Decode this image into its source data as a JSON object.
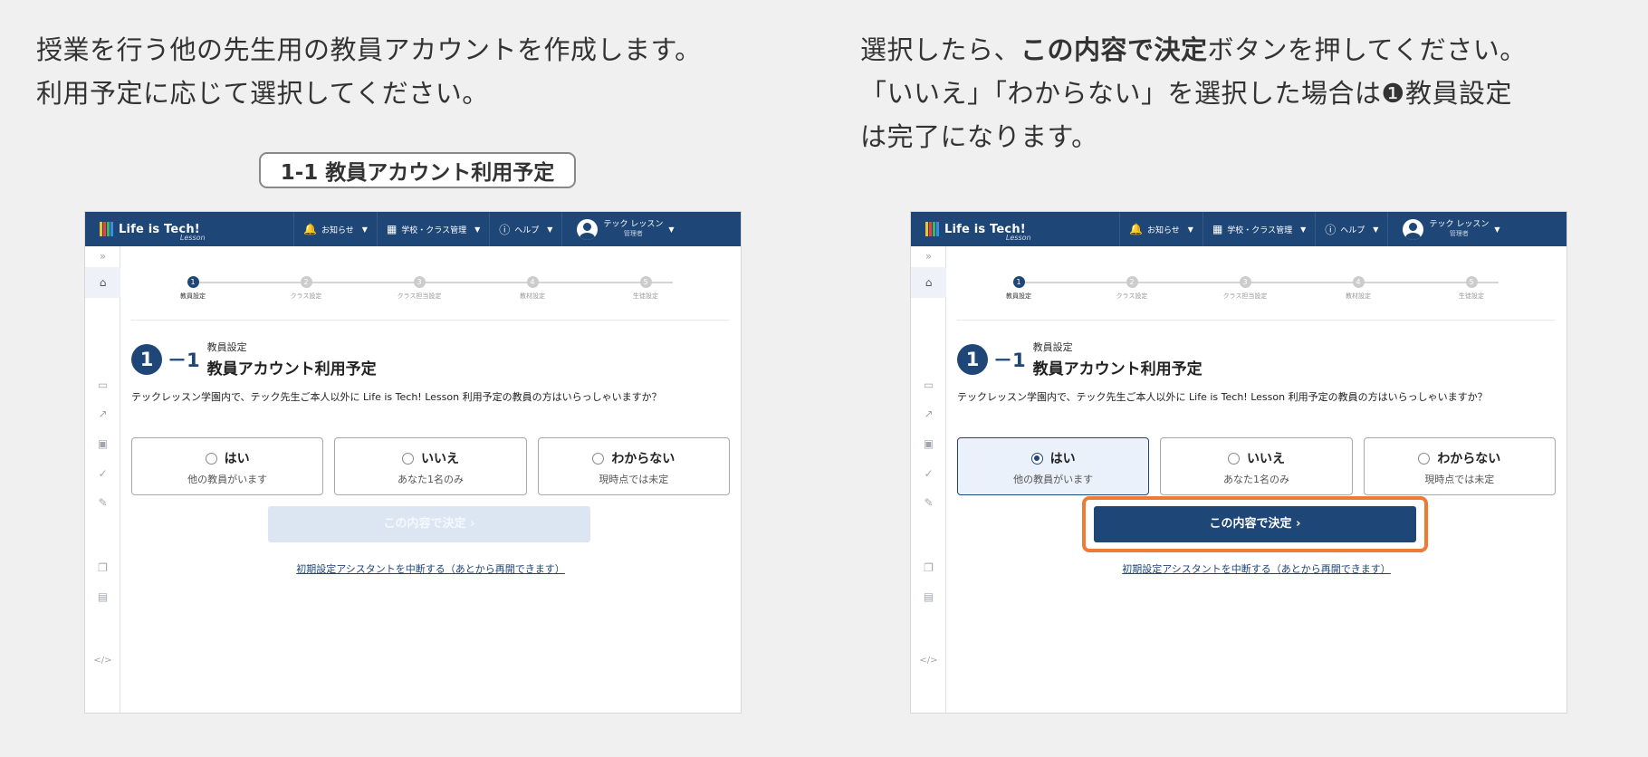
{
  "captions": {
    "left_line1": "授業を行う他の先生用の教員アカウントを作成します。",
    "left_line2": "利用予定に応じて選択してください。",
    "right_line1_bold": "この内容で決定",
    "right_line1_pre": "選択したら、",
    "right_line1_post": "ボタンを押してください。",
    "right_line2": "「いいえ」「わからない」を選択した場合は❶教員設定",
    "right_line3": "は完了になります。",
    "section_label": "1-1 教員アカウント利用予定"
  },
  "app": {
    "logo_text": "Life is Tech!",
    "logo_sub": "Lesson",
    "nav": {
      "notifications": "お知らせ",
      "school_class": "学校・クラス管理",
      "help": "ヘルプ"
    },
    "user": {
      "name": "テック レッスン",
      "role": "管理者"
    },
    "colors": {
      "brand": "#1e4677",
      "highlight": "#ef7a33"
    },
    "steps": [
      {
        "num": "1",
        "label": "教員設定"
      },
      {
        "num": "2",
        "label": "クラス設定"
      },
      {
        "num": "3",
        "label": "クラス担当設定"
      },
      {
        "num": "4",
        "label": "教材設定"
      },
      {
        "num": "5",
        "label": "生徒設定"
      }
    ],
    "section": {
      "num": "1",
      "dash": "－1",
      "small": "教員設定",
      "big": "教員アカウント利用予定"
    },
    "question": "テックレッスン学園内で、テック先生ご本人以外に Life is Tech! Lesson 利用予定の教員の方はいらっしゃいますか？",
    "options": [
      {
        "title": "はい",
        "sub": "他の教員がいます"
      },
      {
        "title": "いいえ",
        "sub": "あなた1名のみ"
      },
      {
        "title": "わからない",
        "sub": "現時点では未定"
      }
    ],
    "decide_label": "この内容で決定 ›",
    "pause_link": "初期設定アシスタントを中断する（あとから再開できます）",
    "sidebar_icons": [
      "expand-icon",
      "home-icon",
      "calendar-icon",
      "chart-icon",
      "monitor-icon",
      "check-icon",
      "pencil-icon",
      "copy-icon",
      "document-icon",
      "code-icon"
    ]
  }
}
